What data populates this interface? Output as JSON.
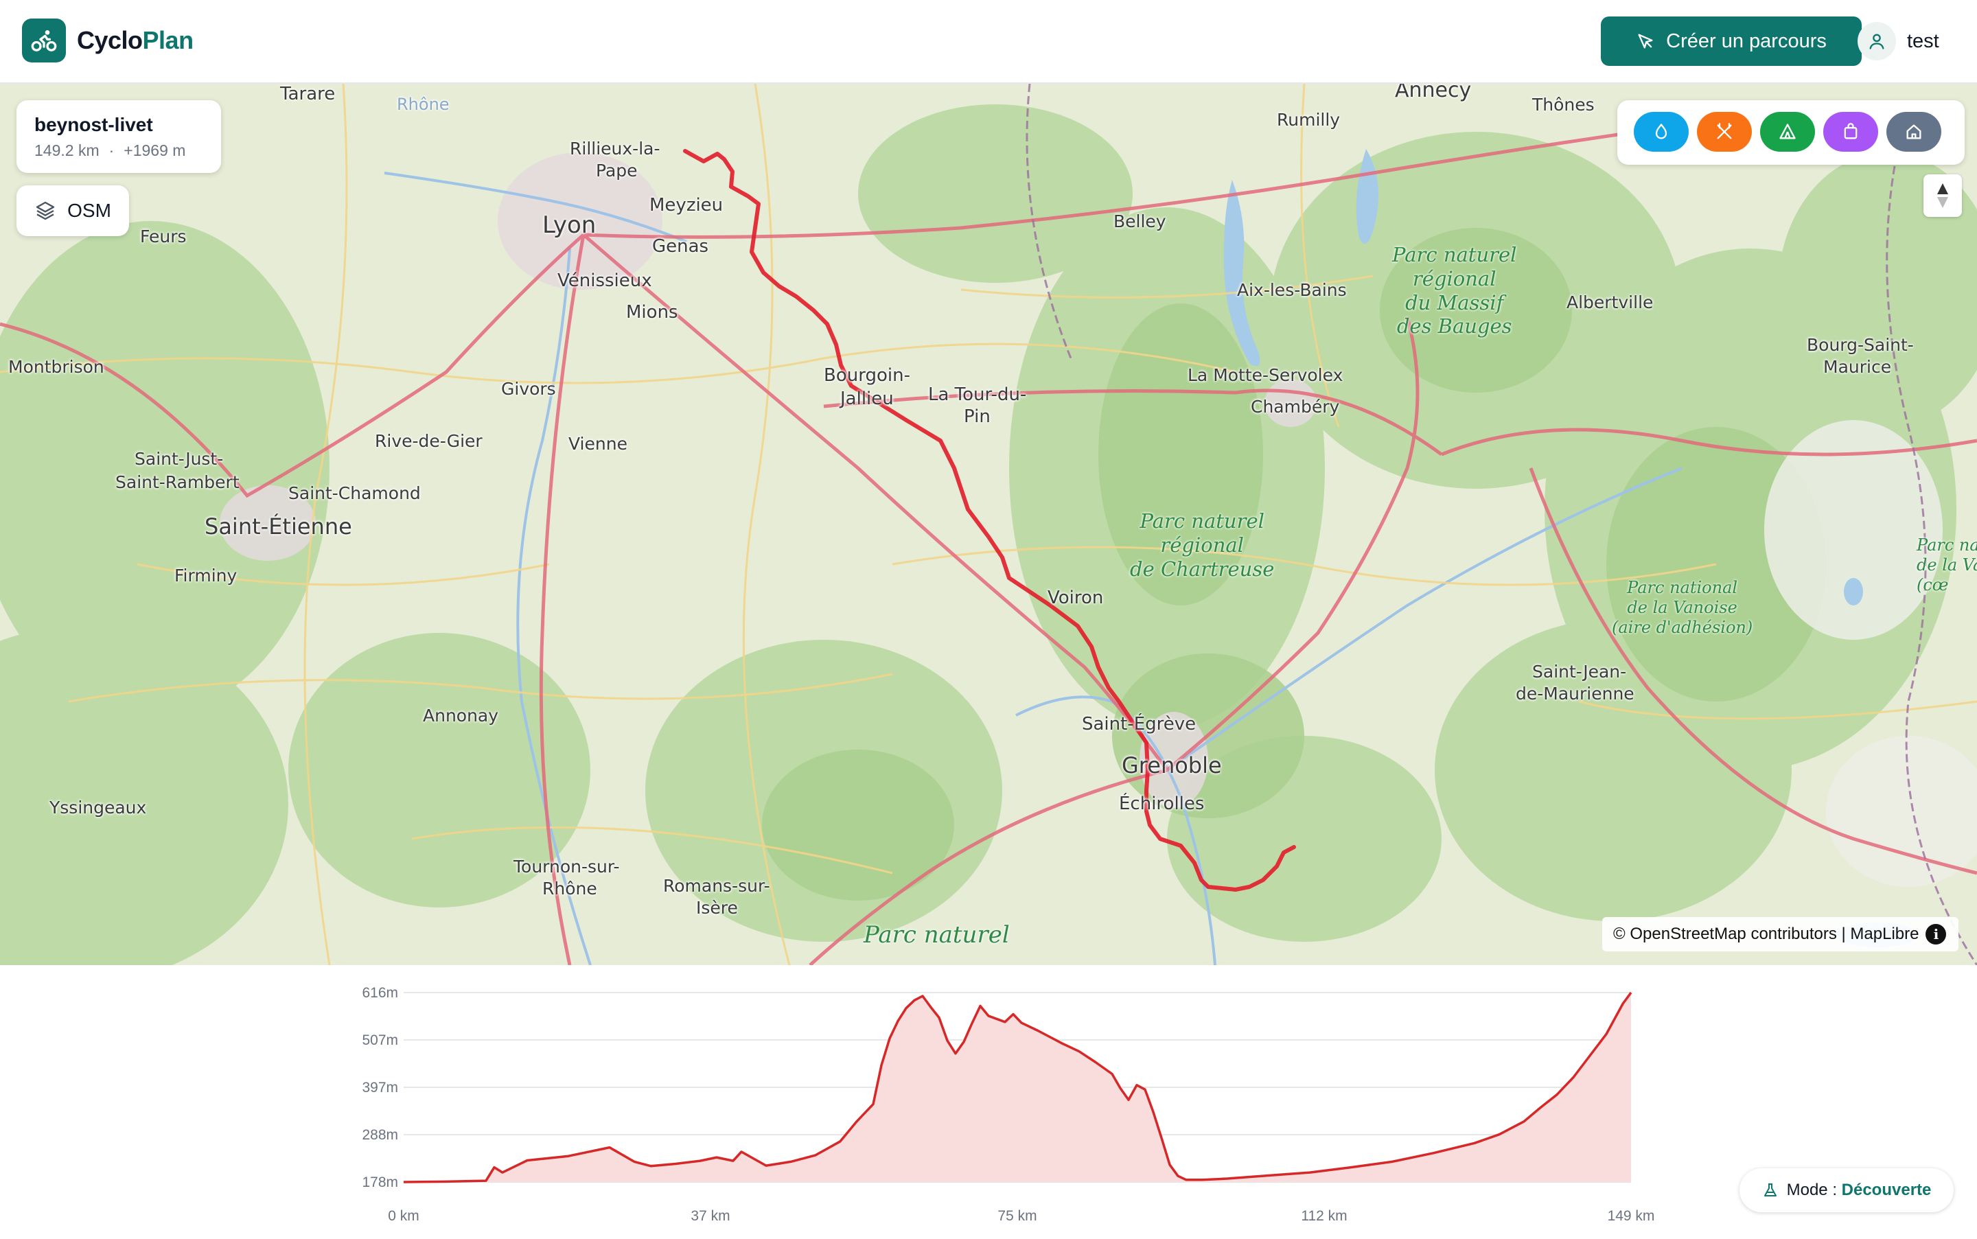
{
  "app": {
    "name_part1": "Cyclo",
    "name_part2": "Plan",
    "logo_icon": "bike-icon"
  },
  "header": {
    "create_label": "Créer un parcours",
    "user_name": "test"
  },
  "route": {
    "name": "beynost-livet",
    "distance": "149.2 km",
    "sep": "·",
    "elevation_gain": "+1969 m"
  },
  "layer": {
    "label": "OSM",
    "icon": "layers-icon"
  },
  "poi_filters": [
    {
      "icon": "water-icon",
      "color": "#0ea5e9"
    },
    {
      "icon": "restaurant-icon",
      "color": "#f97316"
    },
    {
      "icon": "camping-icon",
      "color": "#16a34a"
    },
    {
      "icon": "shop-icon",
      "color": "#a855f7"
    },
    {
      "icon": "lodging-icon",
      "color": "#64748b"
    }
  ],
  "map": {
    "attribution": "© OpenStreetMap contributors | MapLibre",
    "info_glyph": "i",
    "places": [
      "Tarare",
      "Rhône",
      "Rillieux-la-",
      "Pape",
      "Meyzieu",
      "Lyon",
      "Genas",
      "Vénissieux",
      "Mions",
      "Feurs",
      "Montbrison",
      "Givors",
      "Rive-de-Gier",
      "Vienne",
      "Saint-Just-",
      "Saint-Rambert",
      "Saint-Chamond",
      "Saint-Étienne",
      "Firminy",
      "Bourgoin-",
      "Jallieu",
      "La Tour-du-",
      "Pin",
      "Voiron",
      "Saint-Égrève",
      "Grenoble",
      "Échirolles",
      "Annonay",
      "Yssingeaux",
      "Tournon-sur-",
      "Rhône",
      "Romans-sur-",
      "Isère",
      "Annecy",
      "Thônes",
      "Rumilly",
      "Belley",
      "Aix-les-Bains",
      "La Motte-Servolex",
      "Chambéry",
      "Albertville",
      "Bourg-Saint-",
      "Maurice",
      "Saint-Jean-",
      "de-Maurienne"
    ],
    "parks": [
      "Parc naturel\nrégional\ndu Massif\ndes Bauges",
      "Parc naturel\nrégional\nde Chartreuse",
      "Parc national\nde la Vanoise\n(aire d'adhésion)",
      "Parc nat\nde la Va\n(cœ",
      "Parc naturel"
    ]
  },
  "elevation": {
    "y_ticks": [
      "616m",
      "507m",
      "397m",
      "288m",
      "178m"
    ],
    "x_ticks": [
      "0 km",
      "37 km",
      "75 km",
      "112 km",
      "149 km"
    ]
  },
  "mode": {
    "prefix": "Mode : ",
    "value": "Découverte",
    "icon": "flask-icon"
  },
  "colors": {
    "accent": "#0f766e",
    "route": "#e11d2a",
    "profile_fill": "#f9dcdc"
  },
  "chart_data": {
    "type": "area",
    "title": "",
    "xlabel": "",
    "ylabel": "",
    "xlim": [
      0,
      149
    ],
    "ylim": [
      178,
      616
    ],
    "x": [
      0,
      5,
      10,
      11,
      12,
      15,
      20,
      25,
      28,
      30,
      33,
      36,
      38,
      40,
      41,
      44,
      47,
      50,
      53,
      55,
      57,
      58,
      59,
      60,
      61,
      62,
      63,
      64,
      65,
      66,
      67,
      68,
      69,
      70,
      71,
      73,
      74,
      75,
      77,
      80,
      82,
      84,
      86,
      87,
      88,
      89,
      90,
      91,
      92,
      93,
      94,
      95,
      97,
      100,
      105,
      110,
      115,
      120,
      125,
      130,
      133,
      136,
      138,
      140,
      142,
      144,
      146,
      147,
      148,
      149
    ],
    "values": [
      178,
      179,
      181,
      212,
      200,
      228,
      238,
      258,
      225,
      215,
      220,
      227,
      235,
      227,
      248,
      216,
      225,
      240,
      272,
      318,
      358,
      448,
      510,
      550,
      580,
      598,
      608,
      582,
      558,
      505,
      475,
      502,
      545,
      585,
      562,
      548,
      566,
      546,
      528,
      498,
      480,
      455,
      428,
      395,
      368,
      402,
      392,
      340,
      280,
      218,
      192,
      183,
      183,
      186,
      193,
      200,
      212,
      225,
      245,
      268,
      288,
      318,
      350,
      380,
      420,
      470,
      520,
      555,
      590,
      616
    ]
  }
}
